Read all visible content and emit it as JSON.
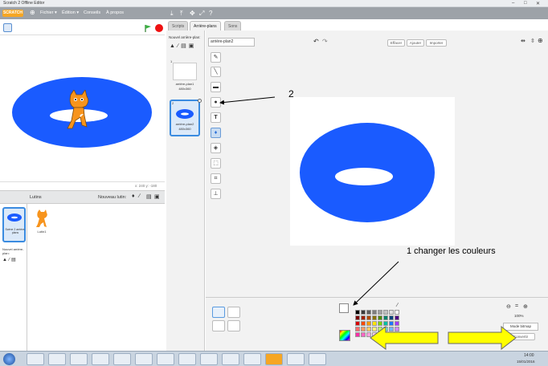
{
  "window": {
    "title": "Scratch 2 Offline Editor",
    "controls": [
      "–",
      "□",
      "✕"
    ]
  },
  "menubar": {
    "logo": "SCRATCH",
    "menus": [
      "Fichier ▾",
      "Édition ▾",
      "Conseils",
      "À propos"
    ],
    "tools": [
      "⤓",
      "⤒",
      "✥",
      "⤢",
      "⤡",
      "?"
    ]
  },
  "stage": {
    "coords": "x: 240  y: -180"
  },
  "sprites": {
    "header_label": "Lutins",
    "new_sprite_label": "Nouveau lutin:",
    "stage_label": "Scène 2 arrière-plans",
    "new_backdrop_label": "Nouvel arrière-plan:",
    "items": [
      {
        "name": "Scène"
      },
      {
        "name": "Lutin1"
      }
    ]
  },
  "editor": {
    "tabs": [
      "Scripts",
      "Arrière-plans",
      "Sons"
    ],
    "active_tab": 1,
    "new_backdrop_label": "Nouvel arrière-plan:",
    "costumes": [
      {
        "index": "1",
        "name": "arrière-plan1",
        "size": "480x360"
      },
      {
        "index": "2",
        "name": "arrière-plan2",
        "size": "480x360"
      }
    ],
    "costume_name": "arrière-plan2",
    "buttons": {
      "clear": "Effacer",
      "add": "Ajouter",
      "import": "Importer"
    },
    "undo_icon": "↶",
    "redo_icon": "↷",
    "zoom_level": "100%",
    "bitmap_label": "Mode bitmap",
    "convert_label": "Convertir"
  },
  "annotations": {
    "label2": "2",
    "label1": "1 changer les couleurs"
  },
  "palette": {
    "colors": [
      "#000000",
      "#3b3b3b",
      "#5e5e5e",
      "#7f7f7f",
      "#9f9f9f",
      "#c0c0c0",
      "#dfdfdf",
      "#ffffff",
      "#7d0000",
      "#a11f00",
      "#b34900",
      "#8b7300",
      "#4d8b00",
      "#00826a",
      "#00457d",
      "#4c0083",
      "#d90000",
      "#ff4b00",
      "#ff9900",
      "#ffe600",
      "#7ed400",
      "#00bfa5",
      "#1f77ff",
      "#a43aff",
      "#ff6b6b",
      "#ff9a63",
      "#ffcc66",
      "#fff177",
      "#b8f06c",
      "#6df0d8",
      "#74b7ff",
      "#d08aff",
      "#ff2ea8",
      "#ff66c4",
      "#ffa0de",
      "#ffd0f0",
      "#f9c8a2",
      "#c98d5c",
      "#8a5a34",
      "#4f2e14"
    ],
    "primary": "#ffffff",
    "secondary": "#000000"
  },
  "taskbar": {
    "time": "14:00",
    "date": "15/01/2016"
  },
  "accent": "#1a5bff"
}
